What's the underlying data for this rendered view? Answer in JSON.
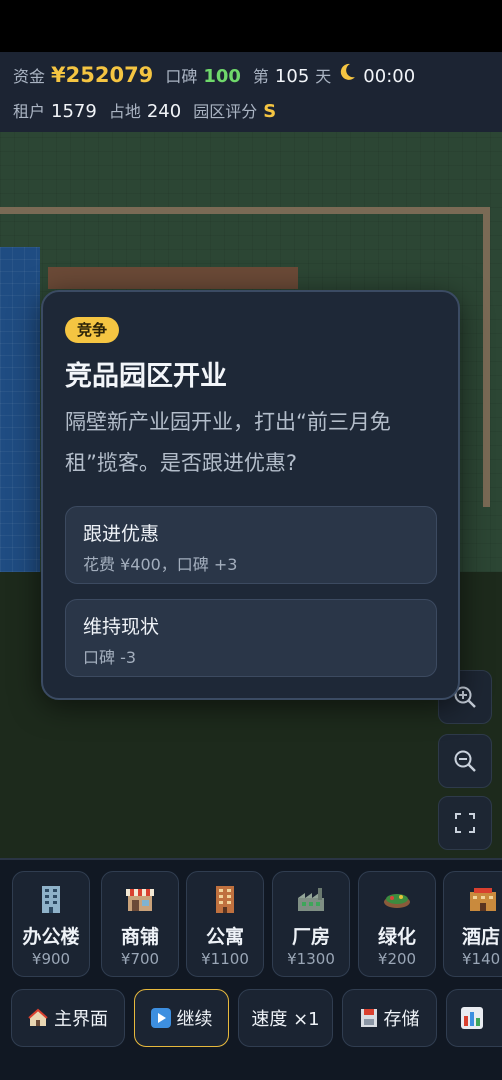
{
  "hud": {
    "funds_label": "资金",
    "funds_value": "¥252079",
    "reputation_label": "口碑",
    "reputation_value": "100",
    "day_prefix": "第",
    "day_value": "105",
    "day_suffix": "天",
    "time": "00:00",
    "time_icon": "moon-icon",
    "tenants_label": "租户",
    "tenants_value": "1579",
    "land_label": "占地",
    "land_value": "240",
    "rating_label": "园区评分",
    "rating_value": "S"
  },
  "event": {
    "tag": "竞争",
    "title": "竞品园区开业",
    "description": "隔壁新产业园开业，打出“前三月免租”揽客。是否跟进优惠?",
    "options": [
      {
        "title": "跟进优惠",
        "effect": "花费 ¥400，口碑 +3"
      },
      {
        "title": "维持现状",
        "effect": "口碑 -3"
      }
    ]
  },
  "map_controls": [
    "zoom-in-icon",
    "zoom-out-icon",
    "fullscreen-icon"
  ],
  "buildings": [
    {
      "name": "办公楼",
      "price": "¥900",
      "icon": "office-building-icon"
    },
    {
      "name": "商铺",
      "price": "¥700",
      "icon": "shop-icon"
    },
    {
      "name": "公寓",
      "price": "¥1100",
      "icon": "apartment-icon"
    },
    {
      "name": "厂房",
      "price": "¥1300",
      "icon": "factory-icon"
    },
    {
      "name": "绿化",
      "price": "¥200",
      "icon": "greenery-icon"
    },
    {
      "name": "酒店",
      "price": "¥140",
      "icon": "hotel-icon"
    }
  ],
  "controls": {
    "home": "主界面",
    "continue": "继续",
    "speed": "速度 ×1",
    "save": "存储"
  },
  "colors": {
    "accent_gold": "#f5c542",
    "reputation_green": "#6fd86b",
    "panel_bg": "#1e2837"
  }
}
